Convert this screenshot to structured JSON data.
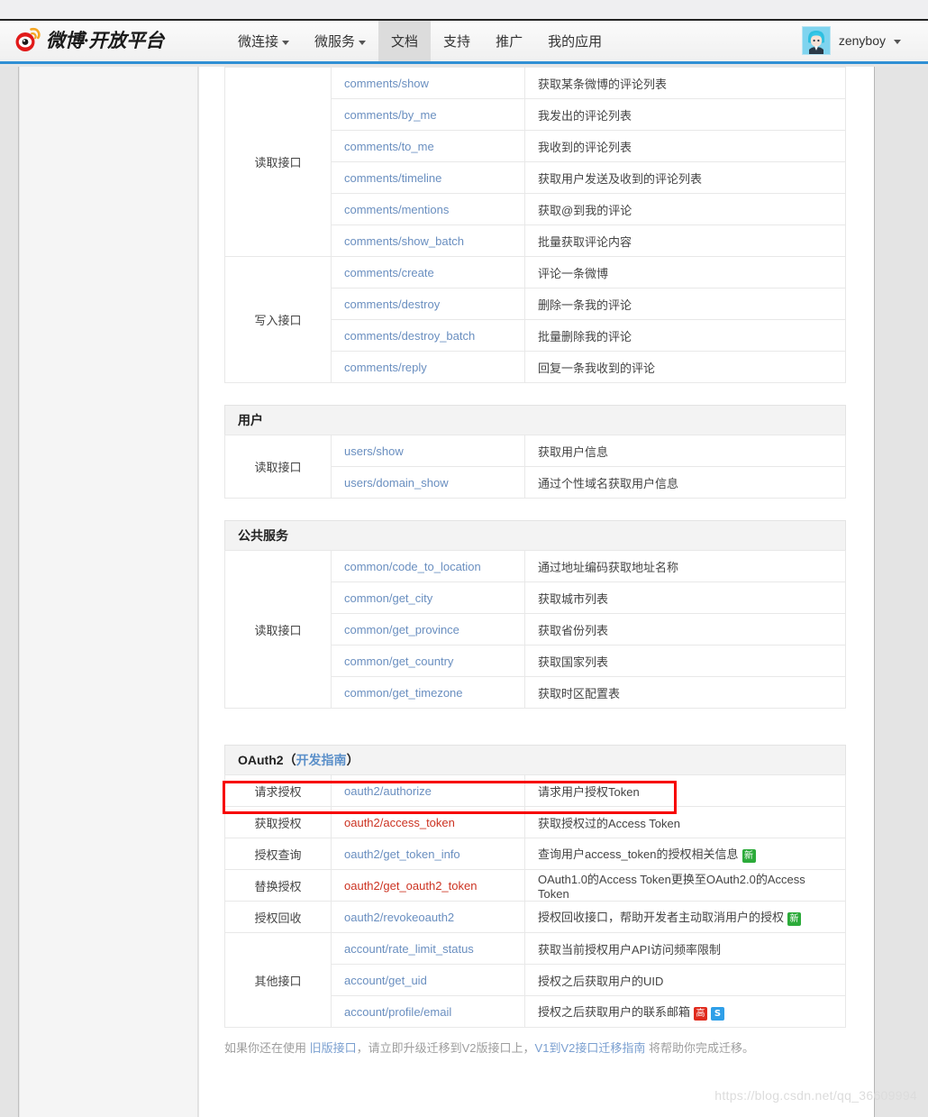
{
  "header": {
    "logo_text": "微博·开放平台",
    "nav": [
      {
        "label": "微连接",
        "has_caret": true,
        "active": false
      },
      {
        "label": "微服务",
        "has_caret": true,
        "active": false
      },
      {
        "label": "文档",
        "has_caret": false,
        "active": true
      },
      {
        "label": "支持",
        "has_caret": false,
        "active": false
      },
      {
        "label": "推广",
        "has_caret": false,
        "active": false
      },
      {
        "label": "我的应用",
        "has_caret": false,
        "active": false
      }
    ],
    "username": "zenyboy"
  },
  "tables": {
    "comments": {
      "rows": [
        {
          "group": "",
          "api": "comments/show",
          "desc": "获取某条微博的评论列表"
        },
        {
          "group": "读取接口",
          "api": "comments/by_me",
          "desc": "我发出的评论列表"
        },
        {
          "group": "",
          "api": "comments/to_me",
          "desc": "我收到的评论列表"
        },
        {
          "group": "",
          "api": "comments/timeline",
          "desc": "获取用户发送及收到的评论列表"
        },
        {
          "group": "",
          "api": "comments/mentions",
          "desc": "获取@到我的评论"
        },
        {
          "group": "",
          "api": "comments/show_batch",
          "desc": "批量获取评论内容"
        },
        {
          "group": "写入接口",
          "api": "comments/create",
          "desc": "评论一条微博"
        },
        {
          "group": "",
          "api": "comments/destroy",
          "desc": "删除一条我的评论"
        },
        {
          "group": "",
          "api": "comments/destroy_batch",
          "desc": "批量删除我的评论"
        },
        {
          "group": "",
          "api": "comments/reply",
          "desc": "回复一条我收到的评论"
        }
      ]
    },
    "users": {
      "section_title": "用户",
      "group_label": "读取接口",
      "rows": [
        {
          "api": "users/show",
          "desc": "获取用户信息"
        },
        {
          "api": "users/domain_show",
          "desc": "通过个性域名获取用户信息"
        }
      ]
    },
    "common": {
      "section_title": "公共服务",
      "group_label": "读取接口",
      "rows": [
        {
          "api": "common/code_to_location",
          "desc": "通过地址编码获取地址名称"
        },
        {
          "api": "common/get_city",
          "desc": "获取城市列表"
        },
        {
          "api": "common/get_province",
          "desc": "获取省份列表"
        },
        {
          "api": "common/get_country",
          "desc": "获取国家列表"
        },
        {
          "api": "common/get_timezone",
          "desc": "获取时区配置表"
        }
      ]
    },
    "oauth2": {
      "section_title": "OAuth2",
      "section_sub": "开发指南",
      "paren_open": "（",
      "paren_close": "）",
      "rows": [
        {
          "group": "请求授权",
          "api": "oauth2/authorize",
          "api_red": false,
          "desc": "请求用户授权Token",
          "badges": []
        },
        {
          "group": "获取授权",
          "api": "oauth2/access_token",
          "api_red": true,
          "desc": "获取授权过的Access Token",
          "badges": [],
          "highlighted": true
        },
        {
          "group": "授权查询",
          "api": "oauth2/get_token_info",
          "api_red": false,
          "desc": "查询用户access_token的授权相关信息",
          "badges": [
            {
              "text": "新",
              "color": "green"
            }
          ]
        },
        {
          "group": "替换授权",
          "api": "oauth2/get_oauth2_token",
          "api_red": true,
          "desc": "OAuth1.0的Access Token更换至OAuth2.0的Access Token",
          "badges": []
        },
        {
          "group": "授权回收",
          "api": "oauth2/revokeoauth2",
          "api_red": false,
          "desc": "授权回收接口，帮助开发者主动取消用户的授权",
          "badges": [
            {
              "text": "新",
              "color": "green"
            }
          ]
        },
        {
          "group": "其他接口",
          "api": "account/rate_limit_status",
          "api_red": false,
          "desc": "获取当前授权用户API访问频率限制",
          "badges": []
        },
        {
          "group": "",
          "api": "account/get_uid",
          "api_red": false,
          "desc": "授权之后获取用户的UID",
          "badges": []
        },
        {
          "group": "",
          "api": "account/profile/email",
          "api_red": false,
          "desc": "授权之后获取用户的联系邮箱",
          "badges": [
            {
              "text": "高",
              "color": "red"
            },
            {
              "text": "S",
              "color": "blue"
            }
          ]
        }
      ]
    }
  },
  "footer": {
    "part1": "如果你还在使用 ",
    "link1": "旧版接口",
    "part2": "，请立即升级迁移到V2版接口上，",
    "link2": "V1到V2接口迁移指南",
    "part3": " 将帮助你完成迁移。"
  },
  "watermark": "https://blog.csdn.net/qq_36609994",
  "colors": {
    "accent_blue": "#2f8fd4",
    "link_blue": "#6a8fc0",
    "highlight_red": "#f70000",
    "api_red": "#cc3322",
    "badge_green": "#2cab3a",
    "badge_red": "#e02b1d",
    "badge_blue": "#2f9fe8"
  }
}
